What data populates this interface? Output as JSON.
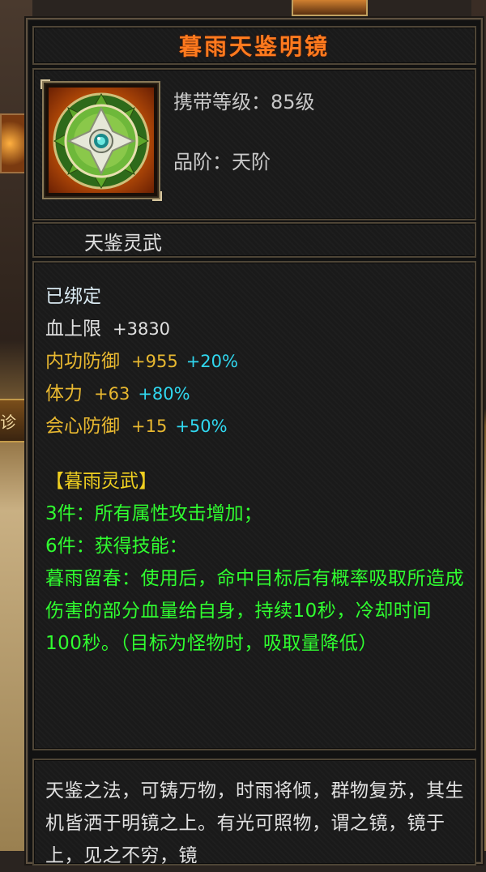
{
  "background": {
    "left_band_text": "诊"
  },
  "item": {
    "title": "暮雨天鉴明镜",
    "icon": "shield-mirror-icon",
    "level_requirement": "携带等级：85级",
    "grade": "品阶：天阶",
    "subname": "天鉴灵武"
  },
  "attributes": {
    "bound": "已绑定",
    "stats": [
      {
        "label": "血上限",
        "value": "+3830",
        "bonus": ""
      },
      {
        "label": "内功防御",
        "value": "+955",
        "bonus": "+20%"
      },
      {
        "label": "体力",
        "value": "+63",
        "bonus": "+80%"
      },
      {
        "label": "会心防御",
        "value": "+15",
        "bonus": "+50%"
      }
    ]
  },
  "set": {
    "title": "【暮雨灵武】",
    "piece3": "3件：所有属性攻击增加；",
    "piece6": "6件：获得技能：",
    "skill_desc": "暮雨留春：使用后，命中目标后有概率吸取所造成伤害的部分血量给自身，持续10秒，冷却时间100秒。（目标为怪物时，吸取量降低）"
  },
  "lore": "天鉴之法，可铸万物，时雨将倾，群物复苏，其生机皆洒于明镜之上。有光可照物，谓之镜，镜于上，见之不穷，镜",
  "colors": {
    "title": "#ff7a1e",
    "gold_stat": "#e8b830",
    "percent_bonus": "#30d8f0",
    "set_text": "#30ff30",
    "set_title": "#f0d020"
  }
}
